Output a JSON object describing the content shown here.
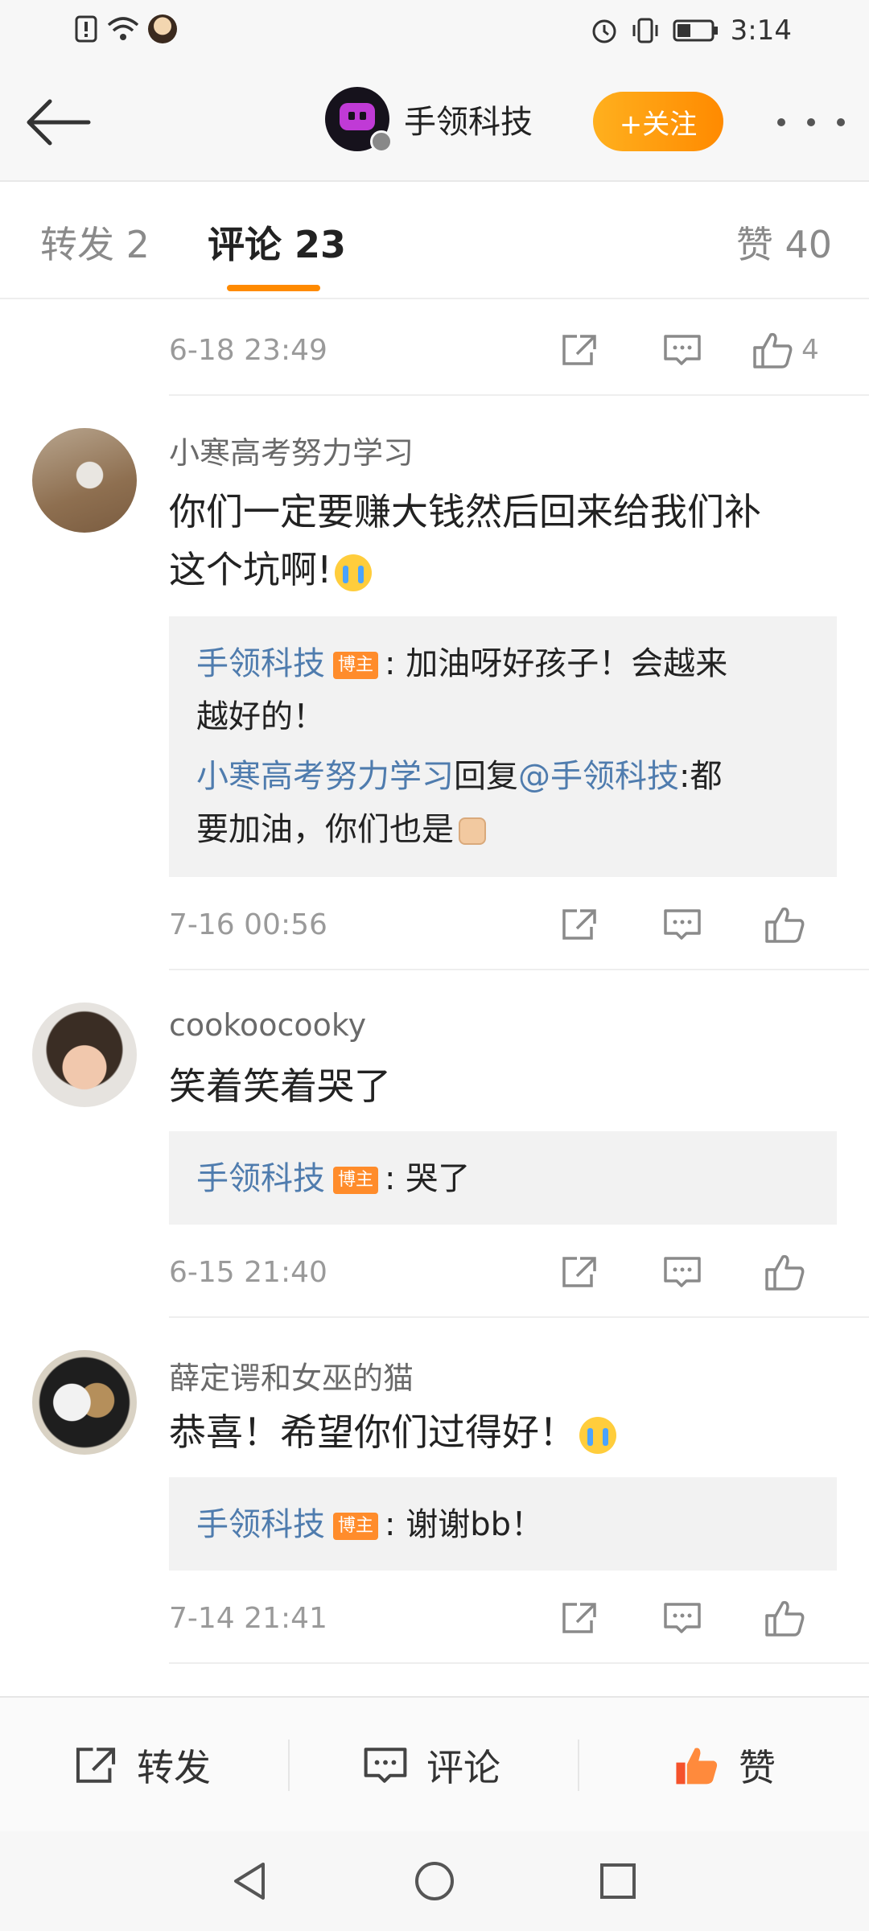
{
  "status_bar": {
    "time": "3:14"
  },
  "header": {
    "blogger_name": "手领科技",
    "follow_label": "+关注"
  },
  "tabs": [
    {
      "label": "转发 2"
    },
    {
      "label": "评论 23"
    },
    {
      "label": "赞 40"
    }
  ],
  "first_comment_tail": {
    "date": "6-18 23:49",
    "like_count": "4"
  },
  "comments": [
    {
      "username": "小寒高考努力学习",
      "text_line1": "你们一定要赚大钱然后回来给我们补",
      "text_line2": "这个坑啊!",
      "replies": [
        {
          "name": "手领科技",
          "badge": "博主",
          "text": ": 加油呀好孩子！会越来",
          "text2": "越好的！"
        },
        {
          "name": "小寒高考努力学习",
          "mid": "回复",
          "mention": "@手领科技",
          "text": ":都",
          "text2": "要加油，你们也是"
        }
      ],
      "date": "7-16 00:56"
    },
    {
      "username": "cookoocooky",
      "text_line1": "笑着笑着哭了",
      "replies": [
        {
          "name": "手领科技",
          "badge": "博主",
          "text": ": 哭了"
        }
      ],
      "date": "6-15 21:40"
    },
    {
      "username": "薛定谔和女巫的猫",
      "text_line1": "恭喜！希望你们过得好！",
      "replies": [
        {
          "name": "手领科技",
          "badge": "博主",
          "text": ": 谢谢bb！"
        }
      ],
      "date": "7-14 21:41"
    }
  ],
  "bottom_bar": {
    "repost_label": "转发",
    "comment_label": "评论",
    "like_label": "赞"
  },
  "colors": {
    "accent": "#ff8a00",
    "link": "#4f7cae",
    "like_active": "#f5522b"
  }
}
